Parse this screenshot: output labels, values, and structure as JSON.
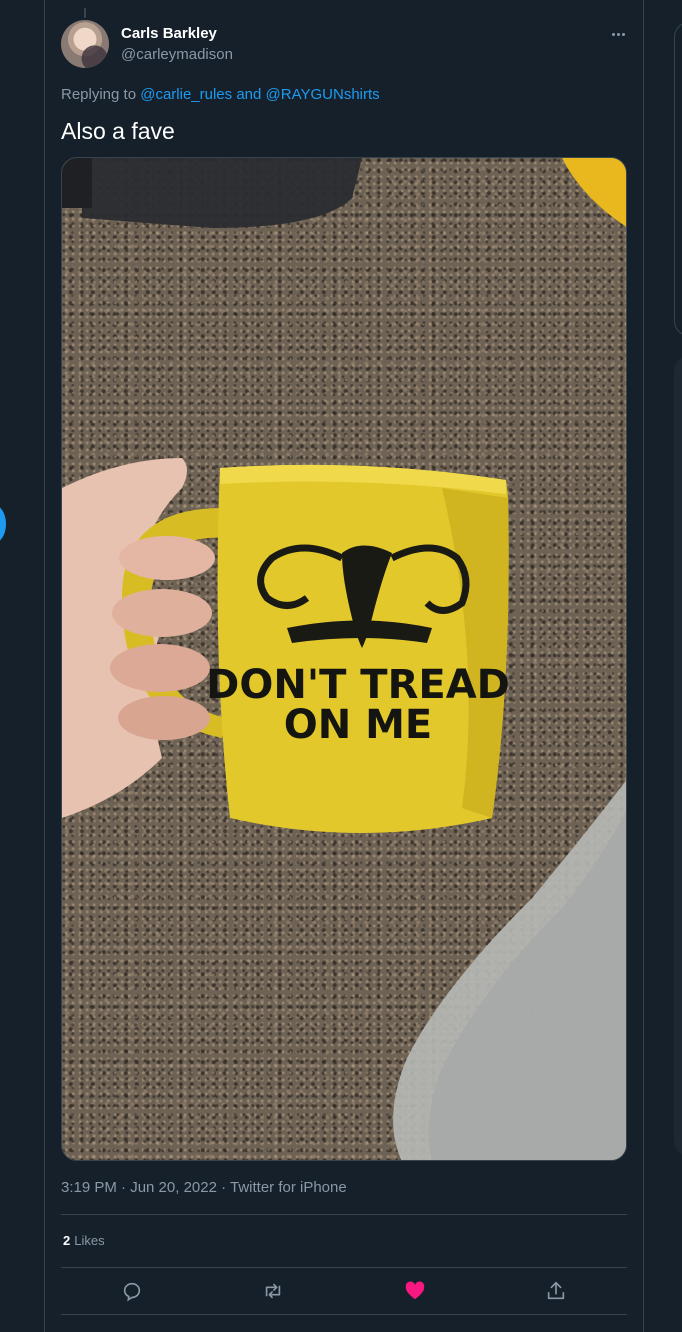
{
  "tweet": {
    "display_name": "Carls Barkley",
    "handle": "@carleymadison",
    "replying_prefix": "Replying to",
    "mention_1": "@carlie_rules",
    "mention_joiner": "and",
    "mention_2": "@RAYGUNshirts",
    "text": "Also a fave",
    "timestamp": "3:19 PM · Jun 20, 2022 · Twitter for iPhone",
    "likes_count": "2",
    "likes_label": "Likes"
  },
  "media": {
    "mug_text_line1": "DON'T TREAD",
    "mug_text_line2": "ON ME",
    "mug_color": "#e2c82a"
  },
  "actions": [
    {
      "icon": "reply-icon"
    },
    {
      "icon": "retweet-icon"
    },
    {
      "icon": "heart-icon",
      "active": true
    },
    {
      "icon": "share-icon"
    }
  ],
  "colors": {
    "background": "#15202b",
    "border": "#38444d",
    "secondary_text": "#8b98a5",
    "accent": "#1d9bf0",
    "like_active": "#f91880"
  }
}
